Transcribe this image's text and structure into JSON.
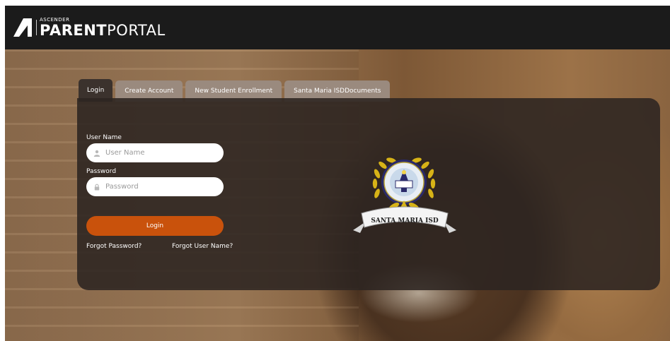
{
  "brand": {
    "small": "ASCENDER",
    "bold": "PARENT",
    "light": "PORTAL"
  },
  "tabs": [
    {
      "label": "Login"
    },
    {
      "label": "Create Account"
    },
    {
      "label": "New Student Enrollment"
    },
    {
      "label": "Santa Maria ISDDocuments"
    }
  ],
  "form": {
    "username_label": "User Name",
    "username_placeholder": "User Name",
    "password_label": "Password",
    "password_placeholder": "Password",
    "login_button": "Login",
    "forgot_password": "Forgot Password?",
    "forgot_username": "Forgot User Name?"
  },
  "seal": {
    "banner": "SANTA MARIA ISD"
  },
  "colors": {
    "accent": "#c9520c",
    "header": "#1b1b1b",
    "panel": "#2c2421"
  },
  "icons": {
    "username": "user-icon",
    "password": "lock-icon",
    "logo": "ascender-logo-icon"
  }
}
